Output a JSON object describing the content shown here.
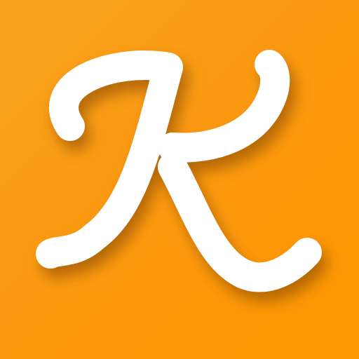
{
  "app_icon": {
    "logo_letter": "K",
    "background_color": "#ff9900",
    "letter_color": "#ffffff",
    "shadow_color": "#7a3e00"
  }
}
